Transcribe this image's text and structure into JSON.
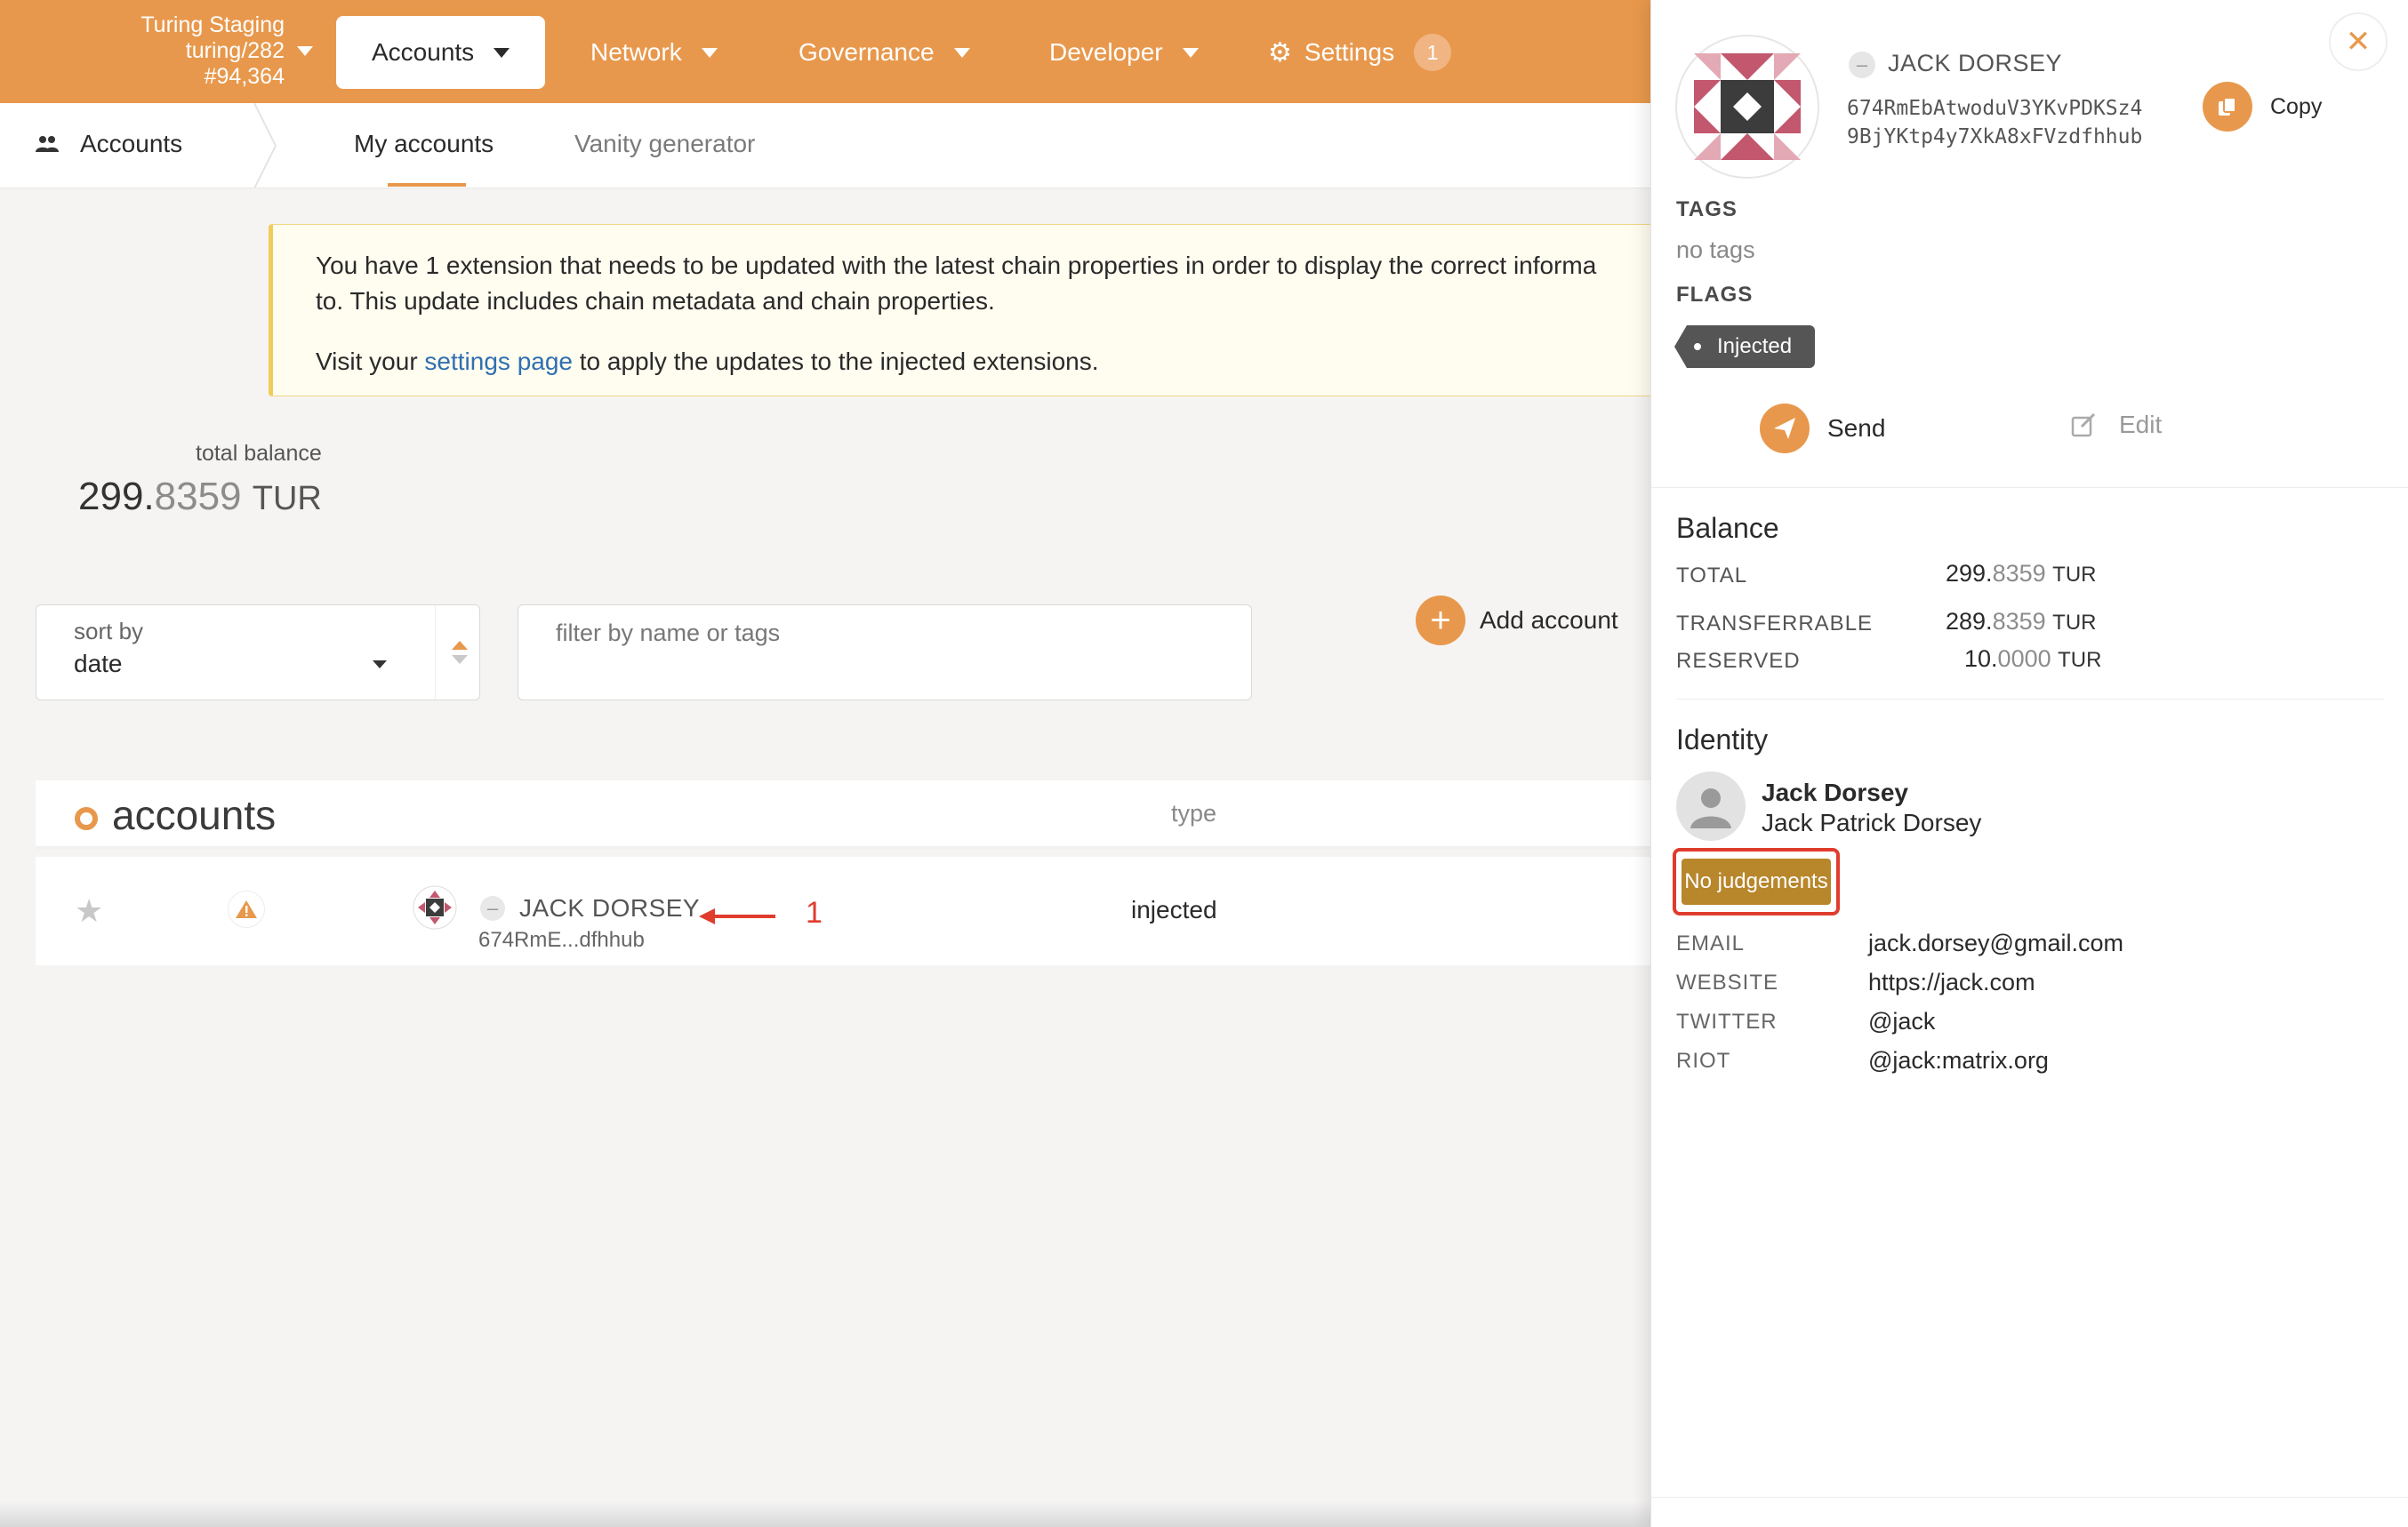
{
  "chain": {
    "name": "Turing Staging",
    "version": "turing/282",
    "block": "#94,364"
  },
  "nav": {
    "tabs": [
      {
        "label": "Accounts",
        "active": true
      },
      {
        "label": "Network"
      },
      {
        "label": "Governance"
      },
      {
        "label": "Developer"
      },
      {
        "label": "Settings",
        "badge": "1"
      }
    ]
  },
  "subnav": {
    "title": "Accounts",
    "tabs": [
      {
        "label": "My accounts",
        "active": true
      },
      {
        "label": "Vanity generator"
      }
    ]
  },
  "warning": {
    "line1": "You have 1 extension that needs to be updated with the latest chain properties in order to display the correct informa",
    "line2": "to. This update includes chain metadata and chain properties.",
    "pre_link": "Visit your ",
    "link": "settings page",
    "post_link": " to apply the updates to the injected extensions."
  },
  "balance": {
    "label": "total balance",
    "int": "299.",
    "dec": "8359",
    "unit": "TUR"
  },
  "controls": {
    "sort_label": "sort by",
    "sort_value": "date",
    "filter_placeholder": "filter by name or tags",
    "add_account": "Add account"
  },
  "table": {
    "title": "accounts",
    "col_type": "type",
    "rows": [
      {
        "name": "JACK DORSEY",
        "address": "674RmE...dfhhub",
        "type": "injected"
      }
    ]
  },
  "annotation": {
    "number": "1",
    "color": "#e03c2e"
  },
  "sidebar": {
    "name": "JACK DORSEY",
    "address_line1": "674RmEbAtwoduV3YKvPDKSz4",
    "address_line2": "9BjYKtp4y7XkA8xFVzdfhhub",
    "copy": "Copy",
    "tags_label": "TAGS",
    "tags_value": "no tags",
    "flags_label": "FLAGS",
    "flag": "Injected",
    "send": "Send",
    "edit": "Edit",
    "balance_title": "Balance",
    "balances": [
      {
        "key": "TOTAL",
        "int": "299.",
        "dec": "8359",
        "unit": "TUR"
      },
      {
        "key": "TRANSFERRABLE",
        "int": "289.",
        "dec": "8359",
        "unit": "TUR"
      },
      {
        "key": "RESERVED",
        "int": "10.",
        "dec": "0000",
        "unit": "TUR"
      }
    ],
    "identity_title": "Identity",
    "display_name": "Jack Dorsey",
    "legal_name": "Jack Patrick Dorsey",
    "judgement": "No judgements",
    "fields": [
      {
        "key": "EMAIL",
        "value": "jack.dorsey@gmail.com"
      },
      {
        "key": "WEBSITE",
        "value": "https://jack.com"
      },
      {
        "key": "TWITTER",
        "value": "@jack"
      },
      {
        "key": "RIOT",
        "value": "@jack:matrix.org"
      }
    ]
  },
  "colors": {
    "accent": "#e8984c",
    "link": "#2f6fb0",
    "judgement": "#b8862b",
    "highlight": "#e03c2e"
  }
}
